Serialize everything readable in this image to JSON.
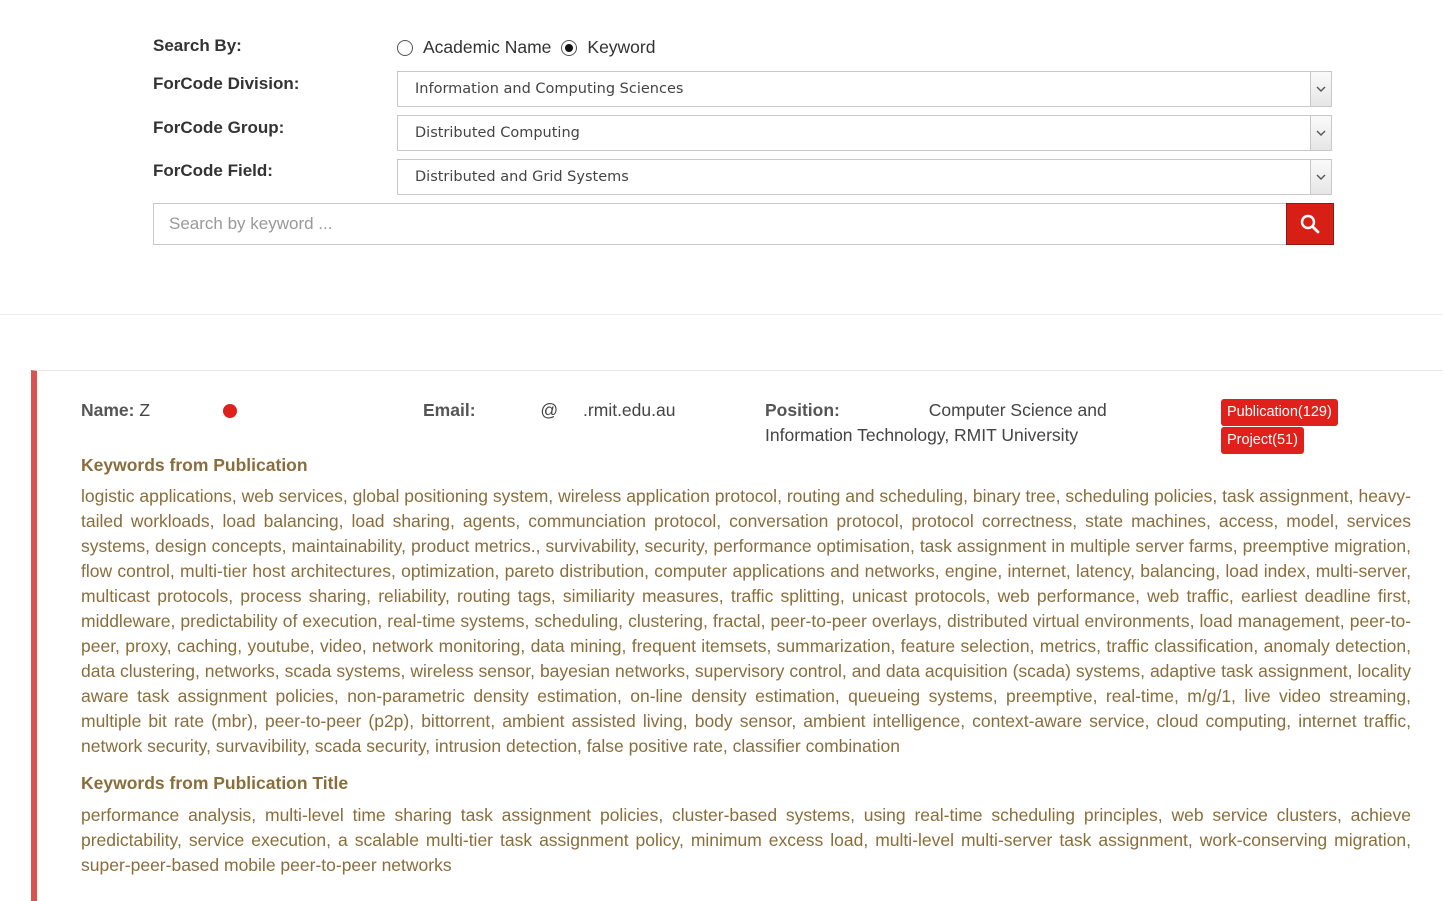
{
  "search": {
    "search_by_label": "Search By:",
    "radio_options": [
      {
        "label": "Academic Name",
        "checked": false
      },
      {
        "label": "Keyword",
        "checked": true
      }
    ],
    "division_label": "ForCode Division:",
    "division_value": "Information and Computing Sciences",
    "group_label": "ForCode Group:",
    "group_value": "Distributed Computing",
    "field_label": "ForCode Field:",
    "field_value": "Distributed and Grid Systems",
    "keyword_placeholder": "Search by keyword ...",
    "search_icon": "magnifier-icon",
    "accent_color": "#d71f15"
  },
  "result": {
    "name_label": "Name:",
    "name_value": "Z",
    "email_label": "Email:",
    "email_at": "@",
    "email_domain": ".rmit.edu.au",
    "position_label": "Position:",
    "position_value": "Computer Science and Information Technology, RMIT University",
    "publication_badge": "Publication(129)",
    "project_badge": "Project(51)",
    "kw_pub_heading": "Keywords from Publication",
    "kw_pub_text": "logistic applications, web services, global positioning system, wireless application protocol, routing and scheduling, binary tree, scheduling policies, task assignment, heavy-tailed workloads, load balancing, load sharing, agents, communciation protocol, conversation protocol, protocol correctness, state machines, access, model, services systems, design concepts, maintainability, product metrics., survivability, security, performance optimisation, task assignment in multiple server farms, preemptive migration, flow control, multi-tier host architectures, optimization, pareto distribution, computer applications and networks, engine, internet, latency, balancing, load index, multi-server, multicast protocols, process sharing, reliability, routing tags, similiarity measures, traffic splitting, unicast protocols, web performance, web traffic, earliest deadline first, middleware, predictability of execution, real-time systems, scheduling, clustering, fractal, peer-to-peer overlays, distributed virtual environments, load management, peer-to-peer, proxy, caching, youtube, video, network monitoring, data mining, frequent itemsets, summarization, feature selection, metrics, traffic classification, anomaly detection, data clustering, networks, scada systems, wireless sensor, bayesian networks, supervisory control, and data acquisition (scada) systems, adaptive task assignment, locality aware task assignment policies, non-parametric density estimation, on-line density estimation, queueing systems, preemptive, real-time, m/g/1, live video streaming, multiple bit rate (mbr), peer-to-peer (p2p), bittorrent, ambient assisted living, body sensor, ambient intelligence, context-aware service, cloud computing, internet traffic, network security, survavibility, scada security, intrusion detection, false positive rate, classifier combination",
    "kw_title_heading": "Keywords from Publication Title",
    "kw_title_text": "performance analysis, multi-level time sharing task assignment policies, cluster-based systems, using real-time scheduling principles, web service clusters, achieve predictability, service execution, a scalable multi-tier task assignment policy, minimum excess load, multi-level multi-server task assignment, work-conserving migration, super-peer-based mobile peer-to-peer networks",
    "card_border_color": "#d9534f",
    "keyword_color": "#8a6d3b",
    "badge_color": "#e0201a"
  }
}
